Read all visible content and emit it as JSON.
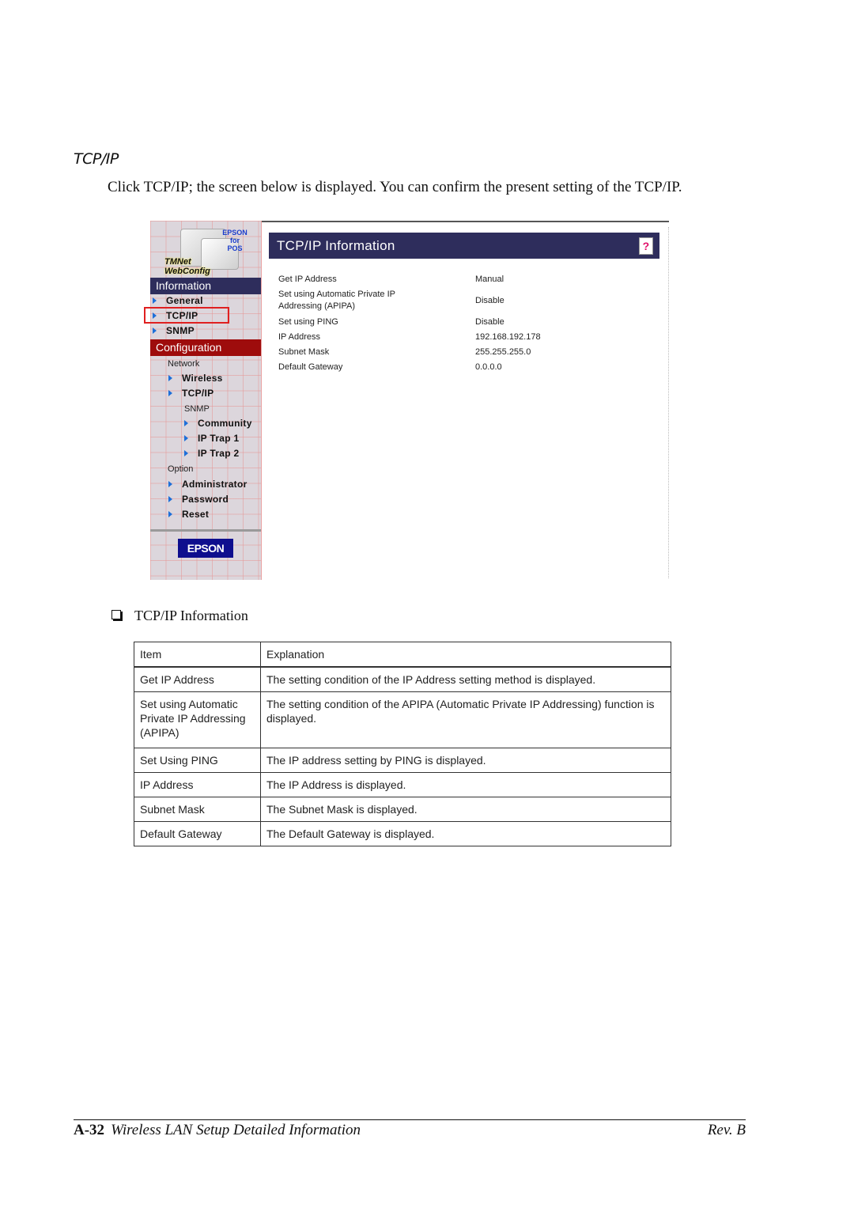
{
  "section_title": "TCP/IP",
  "intro_text": "Click TCP/IP; the screen below is displayed. You can confirm the present setting of the TCP/IP.",
  "screenshot": {
    "logo": {
      "brand_lines": [
        "EPSON",
        "for",
        "POS"
      ],
      "product_lines": [
        "TMNet",
        "WebConfig"
      ]
    },
    "sidebar": {
      "information_header": "Information",
      "information_items": [
        {
          "label": "General"
        },
        {
          "label": "TCP/IP",
          "highlighted": true
        },
        {
          "label": "SNMP"
        }
      ],
      "configuration_header": "Configuration",
      "network_group": "Network",
      "network_items": [
        {
          "label": "Wireless"
        },
        {
          "label": "TCP/IP"
        }
      ],
      "snmp_group": "SNMP",
      "snmp_items": [
        {
          "label": "Community"
        },
        {
          "label": "IP Trap 1"
        },
        {
          "label": "IP Trap 2"
        }
      ],
      "option_group": "Option",
      "option_items": [
        {
          "label": "Administrator"
        },
        {
          "label": "Password"
        },
        {
          "label": "Reset"
        }
      ],
      "footer_logo": "EPSON"
    },
    "main": {
      "title": "TCP/IP Information",
      "help_icon_glyph": "?",
      "rows": [
        {
          "label": "Get IP Address",
          "value": "Manual"
        },
        {
          "label": "Set using Automatic Private IP",
          "label2": "Addressing (APIPA)",
          "value": "Disable"
        },
        {
          "label": "Set using PING",
          "value": "Disable"
        },
        {
          "label": "IP Address",
          "value": "192.168.192.178"
        },
        {
          "label": "Subnet Mask",
          "value": "255.255.255.0"
        },
        {
          "label": "Default Gateway",
          "value": "0.0.0.0"
        }
      ]
    },
    "colors": {
      "nav_header_info": "#2e2d5c",
      "nav_header_config": "#9e0c0c",
      "highlight_box": "#e02020",
      "nav_arrow": "#1e6fd9"
    }
  },
  "sub_heading": "TCP/IP Information",
  "table": {
    "headers": [
      "Item",
      "Explanation"
    ],
    "rows": [
      [
        "Get IP Address",
        "The setting condition of the IP Address setting method is displayed."
      ],
      [
        "Set using Automatic Private IP Addressing (APIPA)",
        "The setting condition of the APIPA (Automatic Private IP Addressing) function is displayed."
      ],
      [
        "Set Using PING",
        "The IP address setting by PING is displayed."
      ],
      [
        "IP Address",
        "The IP Address is displayed."
      ],
      [
        "Subnet Mask",
        "The Subnet Mask is displayed."
      ],
      [
        "Default Gateway",
        "The Default Gateway is displayed."
      ]
    ]
  },
  "footer": {
    "page_number": "A-32",
    "chapter_title": "Wireless LAN Setup Detailed Information",
    "revision": "Rev. B"
  }
}
